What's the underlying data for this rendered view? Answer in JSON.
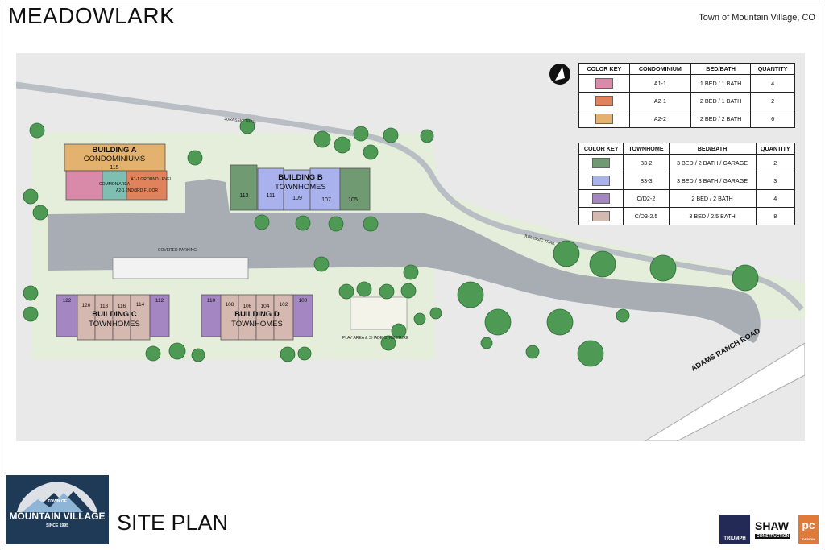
{
  "page": {
    "title": "MEADOWLARK",
    "location": "Town of Mountain Village, CO",
    "sheet_title": "SITE PLAN"
  },
  "map": {
    "buildings": {
      "a": {
        "name": "BUILDING A",
        "type": "CONDOMINIUMS",
        "unit": "115",
        "common_area": "COMMON AREA",
        "ground_level": "A1-1 GROUND LEVEL",
        "upper_floor": "A2-1 2ND/3RD FLOOR"
      },
      "b": {
        "name": "BUILDING B",
        "type": "TOWNHOMES",
        "units": [
          "113",
          "111",
          "109",
          "107",
          "105"
        ]
      },
      "c": {
        "name": "BUILDING C",
        "type": "TOWNHOMES",
        "units": [
          "122",
          "120",
          "118",
          "116",
          "114",
          "112"
        ]
      },
      "d": {
        "name": "BUILDING D",
        "type": "TOWNHOMES",
        "units": [
          "110",
          "108",
          "106",
          "104",
          "102",
          "100"
        ]
      }
    },
    "labels": {
      "trail_1": "JURASSIC TRAIL",
      "trail_2": "JURASSIC TRAIL",
      "covered_parking": "COVERED PARKING",
      "play_area": "PLAY AREA & SHADE STRUCTURE",
      "road": "ADAMS RANCH ROAD"
    },
    "north_arrow": "north-arrow-icon"
  },
  "condo_key": {
    "headers": [
      "COLOR KEY",
      "CONDOMINIUM",
      "BED/BATH",
      "QUANTITY"
    ],
    "rows": [
      {
        "color": "#d88aa8",
        "unit": "A1-1",
        "bedbath": "1 BED / 1 BATH",
        "qty": "4"
      },
      {
        "color": "#e0835d",
        "unit": "A2-1",
        "bedbath": "2 BED / 1 BATH",
        "qty": "2"
      },
      {
        "color": "#e3b26e",
        "unit": "A2-2",
        "bedbath": "2 BED / 2 BATH",
        "qty": "6"
      }
    ]
  },
  "townhome_key": {
    "headers": [
      "COLOR KEY",
      "TOWNHOME",
      "BED/BATH",
      "QUANTITY"
    ],
    "rows": [
      {
        "color": "#6f9a72",
        "unit": "B3-2",
        "bedbath": "3 BED / 2 BATH / GARAGE",
        "qty": "2"
      },
      {
        "color": "#a9b2ec",
        "unit": "B3-3",
        "bedbath": "3 BED / 3 BATH / GARAGE",
        "qty": "3"
      },
      {
        "color": "#a486c2",
        "unit": "C/D2-2",
        "bedbath": "2 BED / 2 BATH",
        "qty": "4"
      },
      {
        "color": "#d5b9b0",
        "unit": "C/D3-2.5",
        "bedbath": "3 BED / 2.5 BATH",
        "qty": "8"
      }
    ]
  },
  "footer": {
    "logo": {
      "line1": "TOWN OF",
      "line2": "MOUNTAIN VILLAGE",
      "line3": "SINCE 1995"
    },
    "sponsors": {
      "triumph": "TRIUMPH",
      "shaw": "SHAW",
      "shaw_sub": "CONSTRUCTION",
      "pc_sub": "DESIGN"
    }
  },
  "colors": {
    "grass": "#e6efdc",
    "pavement": "#a8adb3",
    "tree": "#4e9a55",
    "accent": "#1e3a57"
  }
}
